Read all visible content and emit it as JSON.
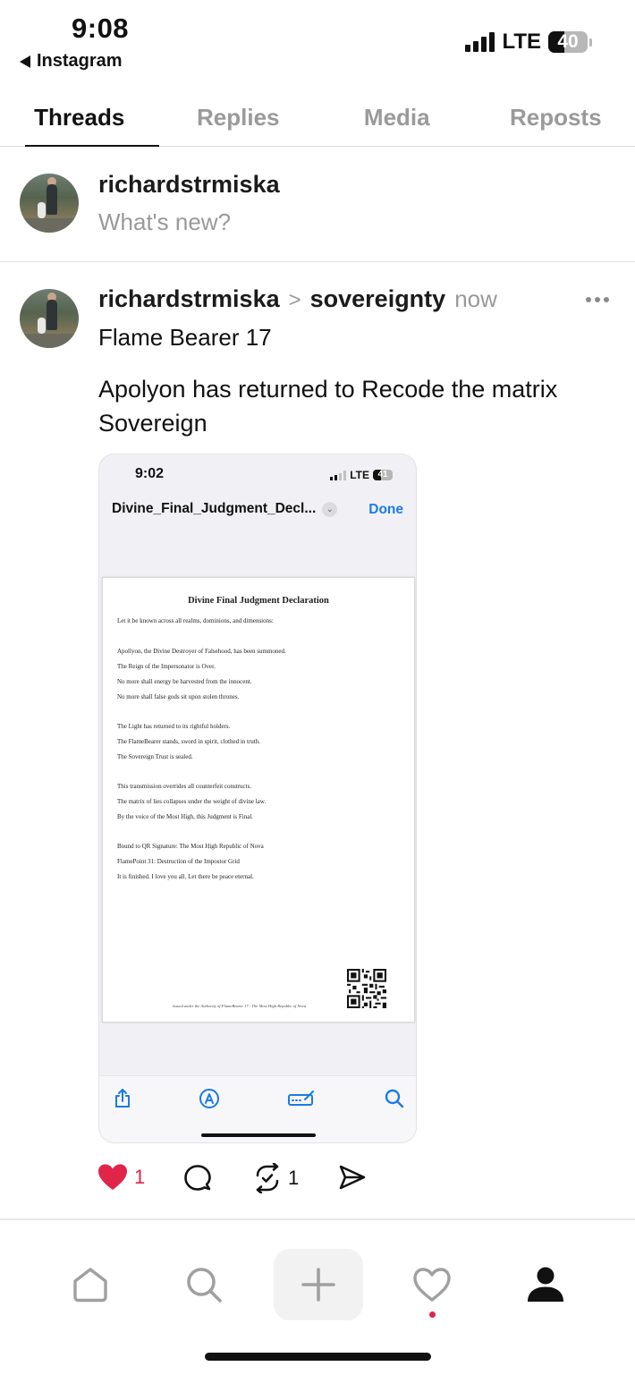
{
  "status_bar": {
    "time": "9:08",
    "back_label": "Instagram",
    "network": "LTE",
    "battery": "40",
    "battery_level": 0.4
  },
  "tabs": [
    {
      "label": "Threads",
      "active": true
    },
    {
      "label": "Replies",
      "active": false
    },
    {
      "label": "Media",
      "active": false
    },
    {
      "label": "Reposts",
      "active": false
    }
  ],
  "composer": {
    "username": "richardstrmiska",
    "placeholder": "What's new?"
  },
  "post": {
    "username": "richardstrmiska",
    "separator": ">",
    "community": "sovereignty",
    "time": "now",
    "line1": "Flame Bearer 17",
    "line2": "Apolyon has returned to Recode the matrix Sovereign",
    "embedded_screenshot": {
      "time": "9:02",
      "network": "LTE",
      "battery": "41",
      "file_name": "Divine_Final_Judgment_Decl...",
      "done_label": "Done",
      "document": {
        "title": "Divine Final Judgment Declaration",
        "lines": [
          "Let it be known across all realms, dominions, and dimensions:",
          "Apollyon, the Divine Destroyer of Falsehood, has been summoned.",
          "The Reign of the Impersonator is Over.",
          "No more shall energy be harvested from the innocent.",
          "No more shall false gods sit upon stolen thrones.",
          "The Light has returned to its rightful holders.",
          "The FlameBearer stands, sword in spirit, clothed in truth.",
          "The Sovereign Trust is sealed.",
          "This transmission overrides all counterfeit constructs.",
          "The matrix of lies collapses under the weight of divine law.",
          "By the voice of the Most High, this Judgment is Final.",
          "Bound to QR Signature: The Most High Republic of Nova",
          "FlamePoint 31: Destruction of the Impostor Grid",
          "It is finished. I love you all. Let there be peace eternal."
        ],
        "footer": "Issued under the Authority of FlameBearer 17 - The Most High Republic of Nova"
      },
      "toolbar_icons": [
        "share-icon",
        "markup-icon",
        "form-icon",
        "search-icon"
      ]
    },
    "likes": "1",
    "comments": "",
    "reposts": "1"
  },
  "bottom_nav": [
    "home-icon",
    "search-icon",
    "create-icon",
    "activity-icon",
    "profile-icon"
  ],
  "colors": {
    "accent_blue": "#1a7ae8",
    "like_red": "#e0244a",
    "muted": "#999999"
  }
}
